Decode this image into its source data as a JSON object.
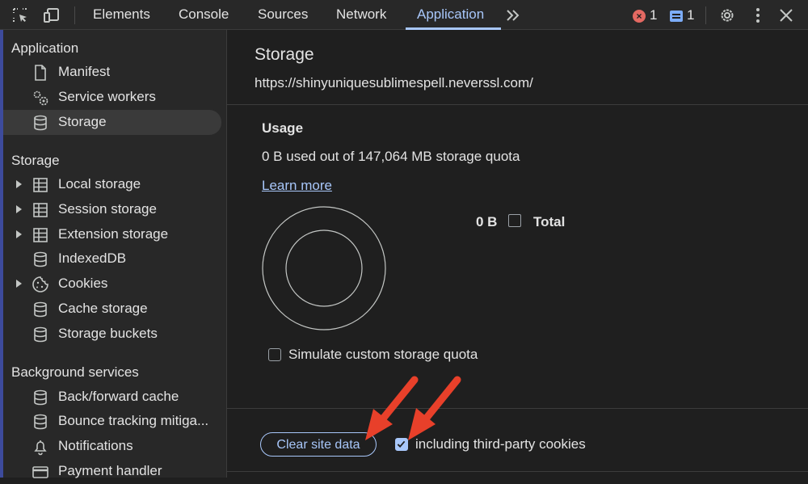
{
  "toolbar": {
    "tabs": [
      {
        "label": "Elements"
      },
      {
        "label": "Console"
      },
      {
        "label": "Sources"
      },
      {
        "label": "Network"
      },
      {
        "label": "Application"
      }
    ],
    "active_tab": "Application",
    "error_count": "1",
    "message_count": "1",
    "icons": [
      "inspect-element-icon",
      "device-toolbar-icon",
      "more-tabs-icon",
      "error-icon",
      "message-icon",
      "gear-icon",
      "kebab-menu-icon",
      "close-icon"
    ]
  },
  "sidebar": {
    "sections": [
      {
        "title": "Application",
        "items": [
          {
            "label": "Manifest",
            "icon": "file-icon"
          },
          {
            "label": "Service workers",
            "icon": "gears-icon"
          },
          {
            "label": "Storage",
            "icon": "database-icon",
            "selected": true
          }
        ]
      },
      {
        "title": "Storage",
        "items": [
          {
            "label": "Local storage",
            "icon": "table-icon",
            "expandable": true
          },
          {
            "label": "Session storage",
            "icon": "table-icon",
            "expandable": true
          },
          {
            "label": "Extension storage",
            "icon": "table-icon",
            "expandable": true
          },
          {
            "label": "IndexedDB",
            "icon": "database-icon"
          },
          {
            "label": "Cookies",
            "icon": "cookie-icon",
            "expandable": true
          },
          {
            "label": "Cache storage",
            "icon": "database-icon"
          },
          {
            "label": "Storage buckets",
            "icon": "database-icon"
          }
        ]
      },
      {
        "title": "Background services",
        "items": [
          {
            "label": "Back/forward cache",
            "icon": "database-icon"
          },
          {
            "label": "Bounce tracking mitiga...",
            "icon": "database-icon"
          },
          {
            "label": "Notifications",
            "icon": "bell-icon"
          },
          {
            "label": "Payment handler",
            "icon": "card-icon"
          }
        ]
      }
    ]
  },
  "main": {
    "title": "Storage",
    "origin": "https://shinyuniquesublimespell.neverssl.com/",
    "usage": {
      "heading": "Usage",
      "text": "0 B used out of 147,064 MB storage quota",
      "learn_more": "Learn more"
    },
    "legend": {
      "value": "0 B",
      "label": "Total"
    },
    "simulate_quota": {
      "label": "Simulate custom storage quota",
      "checked": false
    },
    "clear_button": "Clear site data",
    "third_party": {
      "label": "including third-party cookies",
      "checked": true
    }
  },
  "colors": {
    "accent": "#a8c7fa",
    "annotation_arrow": "#e8402a",
    "background": "#1f1f1f",
    "sidebar": "#282828"
  }
}
